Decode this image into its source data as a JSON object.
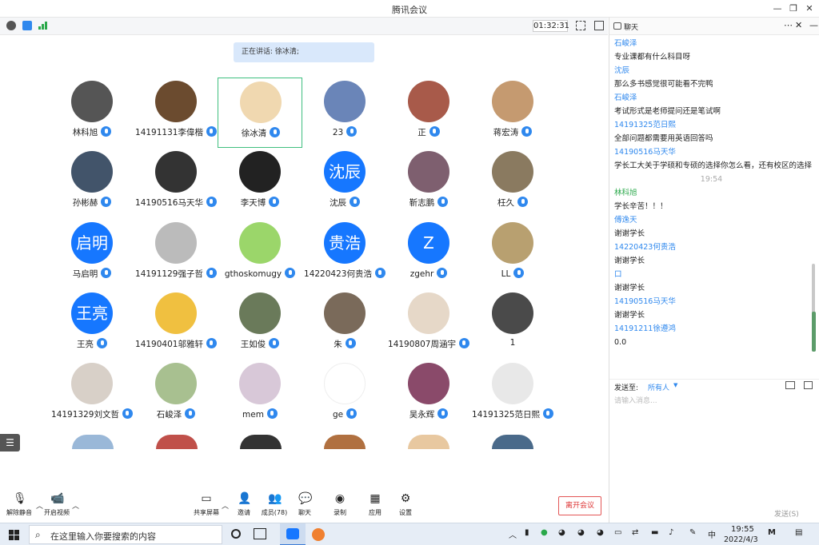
{
  "window": {
    "title": "腾讯会议"
  },
  "status": {
    "timer": "01:32:31"
  },
  "speaking": {
    "text": "正在讲话: 徐冰清;"
  },
  "participants": [
    {
      "name": "林科旭",
      "initials": "",
      "color": "#555"
    },
    {
      "name": "14191131李偉楷",
      "initials": "",
      "color": "#6b4b2f"
    },
    {
      "name": "徐冰清",
      "initials": "",
      "color": "#f0d8b0"
    },
    {
      "name": "23",
      "initials": "",
      "color": "#6a85b8"
    },
    {
      "name": "正",
      "initials": "",
      "color": "#a85a4a"
    },
    {
      "name": "蒋宏涛",
      "initials": "",
      "color": "#c59a70"
    },
    {
      "name": "孙彬赫",
      "initials": "",
      "color": "#42546a"
    },
    {
      "name": "14190516马天华",
      "initials": "",
      "color": "#333"
    },
    {
      "name": "李天博",
      "initials": "",
      "color": "#222"
    },
    {
      "name": "沈辰",
      "initials": "沈辰",
      "color": "#1677ff"
    },
    {
      "name": "靳志鹏",
      "initials": "",
      "color": "#7e5f6f"
    },
    {
      "name": "枉久",
      "initials": "",
      "color": "#8a7a60"
    },
    {
      "name": "马启明",
      "initials": "启明",
      "color": "#1677ff"
    },
    {
      "name": "14191129强子哲",
      "initials": "",
      "color": "#bbb"
    },
    {
      "name": "gthoskomugy",
      "initials": "",
      "color": "#9bd66a"
    },
    {
      "name": "14220423何贵浩",
      "initials": "贵浩",
      "color": "#1677ff"
    },
    {
      "name": "zgehr",
      "initials": "Z",
      "color": "#1677ff"
    },
    {
      "name": "LL",
      "initials": "",
      "color": "#b8a070"
    },
    {
      "name": "王亮",
      "initials": "王亮",
      "color": "#1677ff"
    },
    {
      "name": "14190401邬雅轩",
      "initials": "",
      "color": "#f0c040"
    },
    {
      "name": "王如俊",
      "initials": "",
      "color": "#6a7a5a"
    },
    {
      "name": "朱",
      "initials": "",
      "color": "#7a6a5a"
    },
    {
      "name": "14190807周涵宇",
      "initials": "",
      "color": "#e6d8c8"
    },
    {
      "name": "1",
      "initials": "",
      "color": "#4a4a4a"
    },
    {
      "name": "14191329刘文哲",
      "initials": "",
      "color": "#d8d0c8"
    },
    {
      "name": "石峻泽",
      "initials": "",
      "color": "#a8c090"
    },
    {
      "name": "mem",
      "initials": "",
      "color": "#d8c8d8"
    },
    {
      "name": "ge",
      "initials": "",
      "color": "#fff"
    },
    {
      "name": "吴永辉",
      "initials": "",
      "color": "#8a4a6a"
    },
    {
      "name": "14191325范日熙",
      "initials": "",
      "color": "#e8e8e8"
    }
  ],
  "toolbar": {
    "unmute": "解除静音",
    "video": "开启视频",
    "share": "共享屏幕",
    "invite": "邀请",
    "members": "成员(78)",
    "chat": "聊天",
    "record": "录制",
    "apps": "应用",
    "settings": "设置",
    "leave": "离开会议"
  },
  "chat": {
    "title": "聊天",
    "messages": [
      {
        "who": "石峻泽",
        "text": "专业课都有什么科目呀"
      },
      {
        "who": "沈辰",
        "text": "那么多书感觉很可能看不完鸭"
      },
      {
        "who": "石峻泽",
        "text": "考试形式是老师提问还是笔试啊"
      },
      {
        "who": "14191325范日熙",
        "text": "全部问题都需要用英语回答吗"
      },
      {
        "who": "14190516马天华",
        "text": "学长工大关于学硕和专硕的选择你怎么看，还有校区的选择"
      }
    ],
    "separator": "19:54",
    "messages2": [
      {
        "who": "林科旭",
        "text": "学长辛苦！！！",
        "green": true
      },
      {
        "who": "傅逸天",
        "text": "谢谢学长"
      },
      {
        "who": "14220423何贵浩",
        "text": "谢谢学长"
      },
      {
        "who": "口",
        "text": "谢谢学长"
      },
      {
        "who": "14190516马天华",
        "text": "谢谢学长"
      },
      {
        "who": "14191211徐遵鸿",
        "text": "0.0"
      }
    ],
    "send_to_label": "发送至:",
    "send_to_value": "所有人",
    "input_placeholder": "请输入消息...",
    "send_button": "发送(S)"
  },
  "taskbar": {
    "search_placeholder": "在这里输入你要搜索的内容",
    "ime": "中",
    "time": "19:55",
    "date": "2022/4/3"
  }
}
